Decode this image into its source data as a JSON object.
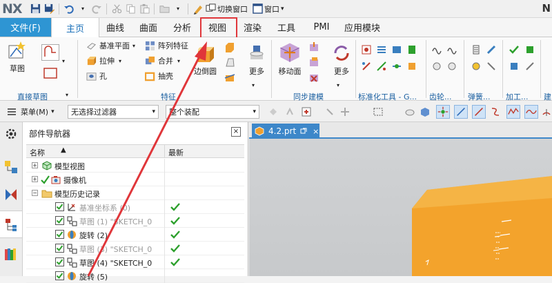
{
  "app": {
    "logo": "NX",
    "right_badge": "N"
  },
  "quick_access": {
    "switch_window": "切换窗口",
    "window_menu": "窗口",
    "window_arrow": "▾"
  },
  "tabs": {
    "file": "文件(F)",
    "items": [
      "主页",
      "曲线",
      "曲面",
      "分析",
      "视图",
      "渲染",
      "工具",
      "PMI",
      "应用模块"
    ],
    "active": "主页",
    "highlighted": "视图"
  },
  "ribbon": {
    "direct_sketch": {
      "sketch": "草图",
      "group": "直接草图"
    },
    "feature": {
      "datum_plane": "基准平面",
      "pattern_feature": "阵列特征",
      "extrude": "拉伸",
      "unite": "合并",
      "hole": "孔",
      "shell": "抽壳",
      "edge_blend": "边倒圆",
      "more": "更多",
      "group": "特征"
    },
    "sync_modeling": {
      "move_face": "移动面",
      "more": "更多",
      "group": "同步建模"
    },
    "standard_tools": {
      "group": "标准化工具 - G..."
    },
    "gear": {
      "group": "齿轮..."
    },
    "spring": {
      "group": "弹簧..."
    },
    "machining": {
      "group": "加工..."
    },
    "cut_off": {
      "group": "建"
    }
  },
  "filterbar": {
    "menu": "菜单(M)",
    "menu_arrow": "▾",
    "filter": "无选择过滤器",
    "scope": "整个装配",
    "dropdown_arrow": "▾"
  },
  "navigator": {
    "title": "部件导航器",
    "col_name": "名称",
    "col_latest": "最新",
    "sort_arrow": "▲",
    "close": "×",
    "rows": [
      {
        "label": "模型视图",
        "expander": "+"
      },
      {
        "label": "摄像机",
        "expander": "+"
      },
      {
        "label": "模型历史记录",
        "expander": "−"
      },
      {
        "label": "基准坐标系 (0)"
      },
      {
        "label": "草图 (1) \"SKETCH_0"
      },
      {
        "label": "旋转 (2)"
      },
      {
        "label": "草图 (3) \"SKETCH_0"
      },
      {
        "label": "草图 (4) \"SKETCH_0"
      },
      {
        "label": "旋转 (5)"
      }
    ]
  },
  "viewport": {
    "tab_label": "4.2.prt",
    "tab_close": "×"
  },
  "colors": {
    "file_tab": "#2e95d3",
    "accent": "#1a6fb8",
    "highlight": "#e0363a",
    "model_front": "#f3a32c",
    "model_top": "#f7bf57",
    "check_green": "#2da02d"
  }
}
